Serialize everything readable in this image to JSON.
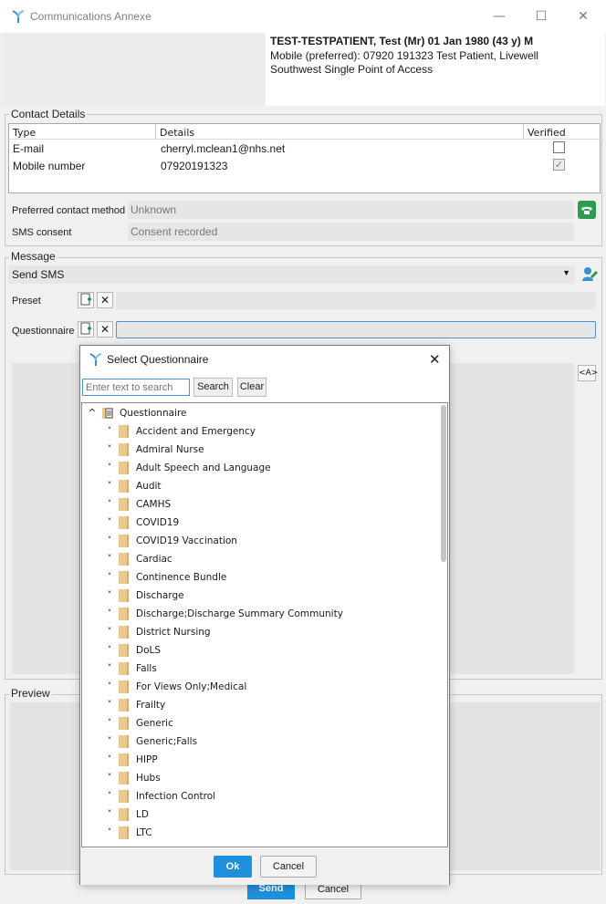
{
  "window": {
    "title": "Communications Annexe",
    "minimize_glyph": "—",
    "maximize_glyph": "☐",
    "close_glyph": "✕"
  },
  "patient": {
    "name_line": "TEST-TESTPATIENT, Test (Mr) 01 Jan 1980 (43 y) M",
    "mobile_line": "Mobile (preferred): 07920 191323   Test Patient, Livewell",
    "service_line": "Southwest Single Point of Access"
  },
  "contact_details": {
    "legend": "Contact Details",
    "columns": [
      "Type",
      "Details",
      "Verified"
    ],
    "rows": [
      {
        "type": "E-mail",
        "details": "cherryl.mclean1@nhs.net",
        "verified": false
      },
      {
        "type": "Mobile number",
        "details": "07920191323",
        "verified": true
      }
    ],
    "preferred_label": "Preferred contact method",
    "preferred_value": "Unknown",
    "sms_consent_label": "SMS consent",
    "sms_consent_value": "Consent recorded"
  },
  "message": {
    "legend": "Message",
    "channel": "Send SMS",
    "preset_label": "Preset",
    "questionnaire_label": "Questionnaire"
  },
  "preview": {
    "legend": "Preview"
  },
  "footer": {
    "send_label": "Send",
    "cancel_label": "Cancel"
  },
  "dialog": {
    "title": "Select Questionnaire",
    "search_placeholder": "Enter text to search",
    "search_label": "Search",
    "clear_label": "Clear",
    "root_label": "Questionnaire",
    "items": [
      "Accident and Emergency",
      "Admiral Nurse",
      "Adult Speech and Language",
      "Audit",
      "CAMHS",
      "COVID19",
      "COVID19 Vaccination",
      "Cardiac",
      "Continence Bundle",
      "Discharge",
      "Discharge;Discharge Summary Community",
      "District Nursing",
      "DoLS",
      "Falls",
      "For Views Only;Medical",
      "Frailty",
      "Generic",
      "Generic;Falls",
      "HIPP",
      "Hubs",
      "Infection Control",
      "LD",
      "LTC"
    ],
    "ok_label": "Ok",
    "cancel_label": "Cancel"
  },
  "colors": {
    "accent": "#1f8fdc",
    "folder": "#e9c98c",
    "phone_icon": "#2e9b4f"
  }
}
